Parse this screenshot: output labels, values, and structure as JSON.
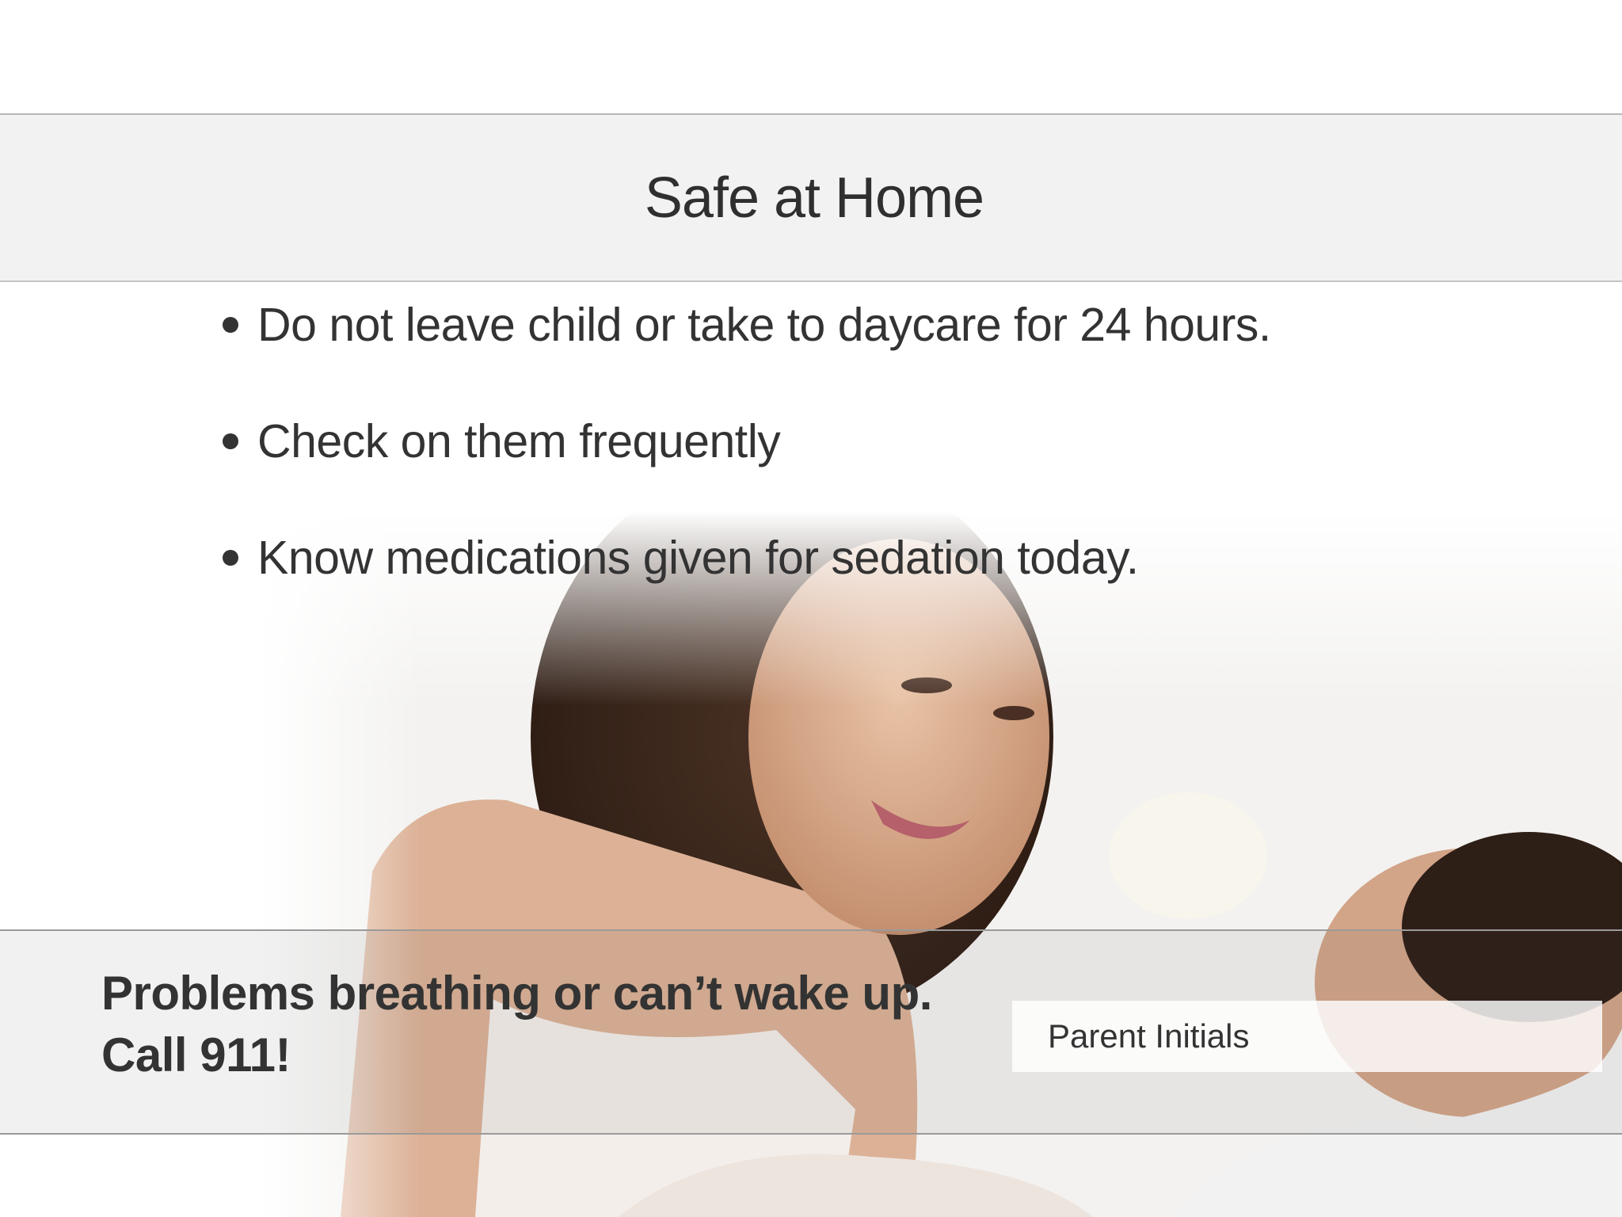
{
  "slide": {
    "title": "Safe at Home",
    "bullets": [
      "Do not leave child or take to daycare for 24 hours.",
      "Check on them frequently",
      "Know medications given for sedation today."
    ],
    "alert": {
      "line1": "Problems breathing or can’t wake up.",
      "line2": "Call 911!"
    },
    "initials_field": {
      "label": "Parent Initials"
    },
    "photo": {
      "icon": "photo-mother-child-icon"
    }
  }
}
